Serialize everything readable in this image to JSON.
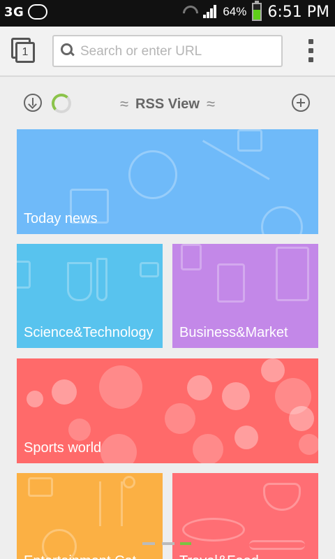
{
  "status_bar": {
    "network": "3G",
    "battery_percent": "64%",
    "battery_level": 0.64,
    "time": "6:51 PM"
  },
  "toolbar": {
    "tab_count": "1",
    "search_placeholder": "Search or enter URL",
    "search_value": ""
  },
  "rss": {
    "title": "RSS View"
  },
  "tiles": [
    {
      "label": "Today news",
      "color": "#6fbaf9"
    },
    {
      "label": "Science&Technology",
      "color": "#58c3ee"
    },
    {
      "label": "Business&Market",
      "color": "#c388e8"
    },
    {
      "label": "Sports world",
      "color": "#ff6a6a"
    },
    {
      "label": "Entertainment Cat...",
      "color": "#fbb044"
    },
    {
      "label": "Travel&Food",
      "color": "#ff6e74"
    }
  ],
  "icons": {
    "tabs": "tabs-icon",
    "search": "search-icon",
    "menu": "overflow-menu-icon",
    "download": "download-icon",
    "refresh": "loading-spinner-icon",
    "add": "add-icon"
  },
  "colors": {
    "accent_green": "#7cc242",
    "status_bar_bg": "#111111"
  }
}
